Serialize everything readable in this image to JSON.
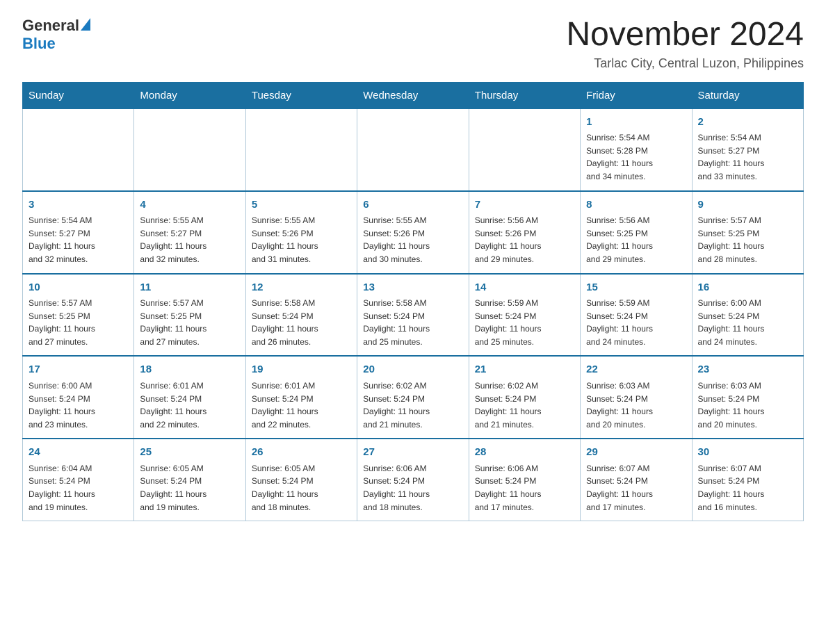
{
  "header": {
    "logo_general": "General",
    "logo_blue": "Blue",
    "month_year": "November 2024",
    "location": "Tarlac City, Central Luzon, Philippines"
  },
  "days_of_week": [
    "Sunday",
    "Monday",
    "Tuesday",
    "Wednesday",
    "Thursday",
    "Friday",
    "Saturday"
  ],
  "weeks": [
    [
      {
        "day": "",
        "info": ""
      },
      {
        "day": "",
        "info": ""
      },
      {
        "day": "",
        "info": ""
      },
      {
        "day": "",
        "info": ""
      },
      {
        "day": "",
        "info": ""
      },
      {
        "day": "1",
        "info": "Sunrise: 5:54 AM\nSunset: 5:28 PM\nDaylight: 11 hours\nand 34 minutes."
      },
      {
        "day": "2",
        "info": "Sunrise: 5:54 AM\nSunset: 5:27 PM\nDaylight: 11 hours\nand 33 minutes."
      }
    ],
    [
      {
        "day": "3",
        "info": "Sunrise: 5:54 AM\nSunset: 5:27 PM\nDaylight: 11 hours\nand 32 minutes."
      },
      {
        "day": "4",
        "info": "Sunrise: 5:55 AM\nSunset: 5:27 PM\nDaylight: 11 hours\nand 32 minutes."
      },
      {
        "day": "5",
        "info": "Sunrise: 5:55 AM\nSunset: 5:26 PM\nDaylight: 11 hours\nand 31 minutes."
      },
      {
        "day": "6",
        "info": "Sunrise: 5:55 AM\nSunset: 5:26 PM\nDaylight: 11 hours\nand 30 minutes."
      },
      {
        "day": "7",
        "info": "Sunrise: 5:56 AM\nSunset: 5:26 PM\nDaylight: 11 hours\nand 29 minutes."
      },
      {
        "day": "8",
        "info": "Sunrise: 5:56 AM\nSunset: 5:25 PM\nDaylight: 11 hours\nand 29 minutes."
      },
      {
        "day": "9",
        "info": "Sunrise: 5:57 AM\nSunset: 5:25 PM\nDaylight: 11 hours\nand 28 minutes."
      }
    ],
    [
      {
        "day": "10",
        "info": "Sunrise: 5:57 AM\nSunset: 5:25 PM\nDaylight: 11 hours\nand 27 minutes."
      },
      {
        "day": "11",
        "info": "Sunrise: 5:57 AM\nSunset: 5:25 PM\nDaylight: 11 hours\nand 27 minutes."
      },
      {
        "day": "12",
        "info": "Sunrise: 5:58 AM\nSunset: 5:24 PM\nDaylight: 11 hours\nand 26 minutes."
      },
      {
        "day": "13",
        "info": "Sunrise: 5:58 AM\nSunset: 5:24 PM\nDaylight: 11 hours\nand 25 minutes."
      },
      {
        "day": "14",
        "info": "Sunrise: 5:59 AM\nSunset: 5:24 PM\nDaylight: 11 hours\nand 25 minutes."
      },
      {
        "day": "15",
        "info": "Sunrise: 5:59 AM\nSunset: 5:24 PM\nDaylight: 11 hours\nand 24 minutes."
      },
      {
        "day": "16",
        "info": "Sunrise: 6:00 AM\nSunset: 5:24 PM\nDaylight: 11 hours\nand 24 minutes."
      }
    ],
    [
      {
        "day": "17",
        "info": "Sunrise: 6:00 AM\nSunset: 5:24 PM\nDaylight: 11 hours\nand 23 minutes."
      },
      {
        "day": "18",
        "info": "Sunrise: 6:01 AM\nSunset: 5:24 PM\nDaylight: 11 hours\nand 22 minutes."
      },
      {
        "day": "19",
        "info": "Sunrise: 6:01 AM\nSunset: 5:24 PM\nDaylight: 11 hours\nand 22 minutes."
      },
      {
        "day": "20",
        "info": "Sunrise: 6:02 AM\nSunset: 5:24 PM\nDaylight: 11 hours\nand 21 minutes."
      },
      {
        "day": "21",
        "info": "Sunrise: 6:02 AM\nSunset: 5:24 PM\nDaylight: 11 hours\nand 21 minutes."
      },
      {
        "day": "22",
        "info": "Sunrise: 6:03 AM\nSunset: 5:24 PM\nDaylight: 11 hours\nand 20 minutes."
      },
      {
        "day": "23",
        "info": "Sunrise: 6:03 AM\nSunset: 5:24 PM\nDaylight: 11 hours\nand 20 minutes."
      }
    ],
    [
      {
        "day": "24",
        "info": "Sunrise: 6:04 AM\nSunset: 5:24 PM\nDaylight: 11 hours\nand 19 minutes."
      },
      {
        "day": "25",
        "info": "Sunrise: 6:05 AM\nSunset: 5:24 PM\nDaylight: 11 hours\nand 19 minutes."
      },
      {
        "day": "26",
        "info": "Sunrise: 6:05 AM\nSunset: 5:24 PM\nDaylight: 11 hours\nand 18 minutes."
      },
      {
        "day": "27",
        "info": "Sunrise: 6:06 AM\nSunset: 5:24 PM\nDaylight: 11 hours\nand 18 minutes."
      },
      {
        "day": "28",
        "info": "Sunrise: 6:06 AM\nSunset: 5:24 PM\nDaylight: 11 hours\nand 17 minutes."
      },
      {
        "day": "29",
        "info": "Sunrise: 6:07 AM\nSunset: 5:24 PM\nDaylight: 11 hours\nand 17 minutes."
      },
      {
        "day": "30",
        "info": "Sunrise: 6:07 AM\nSunset: 5:24 PM\nDaylight: 11 hours\nand 16 minutes."
      }
    ]
  ]
}
